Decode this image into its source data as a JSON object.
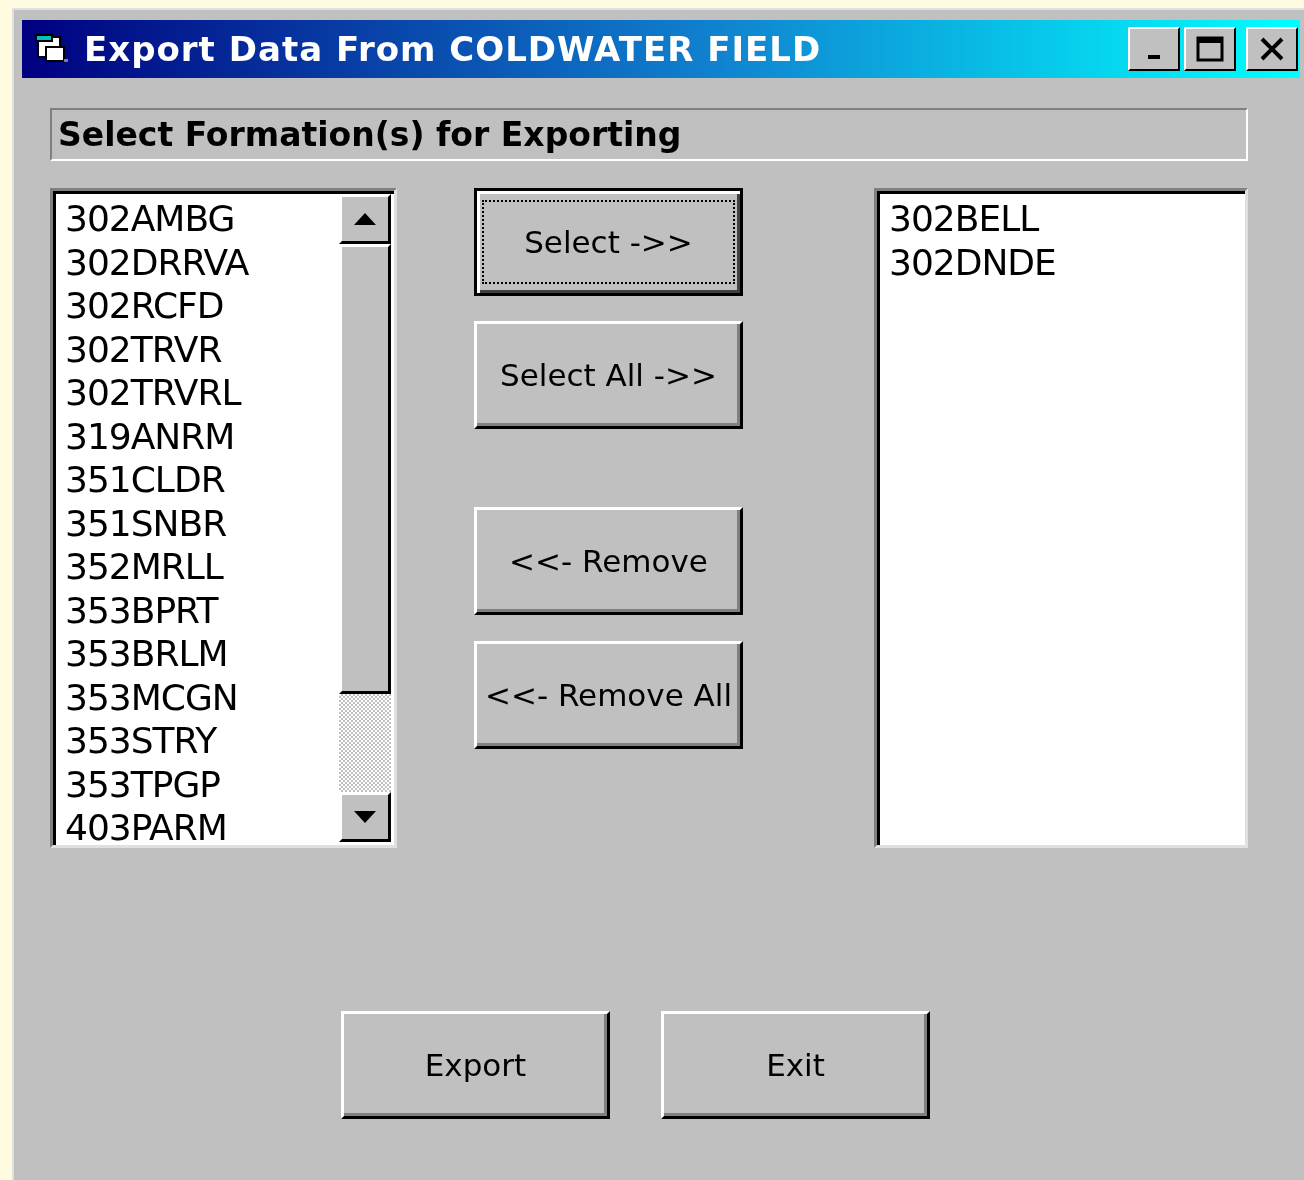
{
  "window": {
    "title": "Export Data From COLDWATER FIELD"
  },
  "heading": "Select Formation(s) for Exporting",
  "available_list": {
    "items": [
      "302AMBG",
      "302DRRVA",
      "302RCFD",
      "302TRVR",
      "302TRVRL",
      "319ANRM",
      "351CLDR",
      "351SNBR",
      "352MRLL",
      "353BPRT",
      "353BRLM",
      "353MCGN",
      "353STRY",
      "353TPGP",
      "403PARM"
    ]
  },
  "actions": [
    {
      "label": "Select ->>",
      "focused": true
    },
    {
      "label": "Select All ->>",
      "focused": false
    },
    {
      "label": "<<- Remove",
      "focused": false
    },
    {
      "label": "<<- Remove All",
      "focused": false
    }
  ],
  "selected_list": {
    "items": [
      "302BELL",
      "302DNDE"
    ]
  },
  "buttons": [
    {
      "label": "Export",
      "focused": false
    },
    {
      "label": "Exit",
      "focused": false
    }
  ]
}
